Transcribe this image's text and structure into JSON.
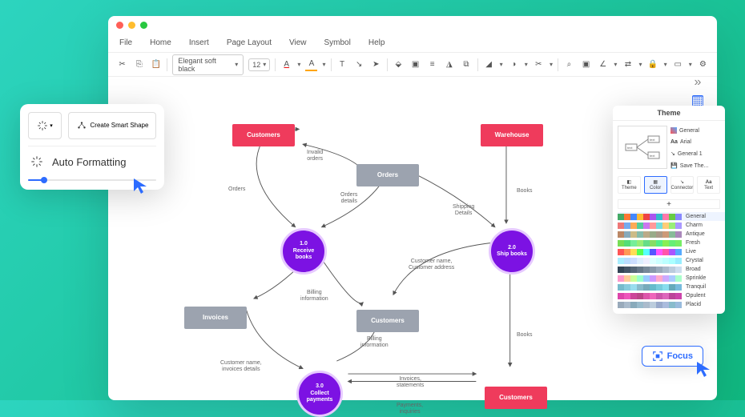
{
  "menubar": [
    "File",
    "Home",
    "Insert",
    "Page Layout",
    "View",
    "Symbol",
    "Help"
  ],
  "toolbar": {
    "font": "Elegant soft black",
    "size": "12"
  },
  "auto_popup": {
    "create_label": "Create Smart Shape",
    "auto_label": "Auto Formatting"
  },
  "theme_panel": {
    "title": "Theme",
    "options": [
      "General",
      "Arial",
      "General 1",
      "Save The..."
    ],
    "tabs": [
      "Theme",
      "Color",
      "Connector",
      "Text"
    ],
    "palettes": [
      "General",
      "Charm",
      "Antique",
      "Fresh",
      "Live",
      "Crystal",
      "Broad",
      "Sprinkle",
      "Tranquil",
      "Opulent",
      "Placid"
    ]
  },
  "focus": {
    "label": "Focus"
  },
  "diagram": {
    "nodes": {
      "customers1": "Customers",
      "warehouse": "Warehouse",
      "orders": "Orders",
      "invoices": "Invoices",
      "customers2": "Customers",
      "customers3": "Customers",
      "receive": "1.0\nReceive books",
      "ship": "2.0\nShip books",
      "collect": "3.0\nCollect payments"
    },
    "labels": {
      "invalid": "Invalid\norders",
      "orders": "Orders",
      "orders_details": "Orders\ndetails",
      "shipping": "Shipping\nDetails",
      "books1": "Books",
      "books2": "Books",
      "billing1": "Billing\ninformation",
      "billing2": "Billing\ninformation",
      "custname": "Customer name,\nCustomer address",
      "custinv": "Customer name,\ninvoices details",
      "invstat": "Invoices,\nstatements",
      "payinq": "Payments,\ninquiries"
    }
  }
}
